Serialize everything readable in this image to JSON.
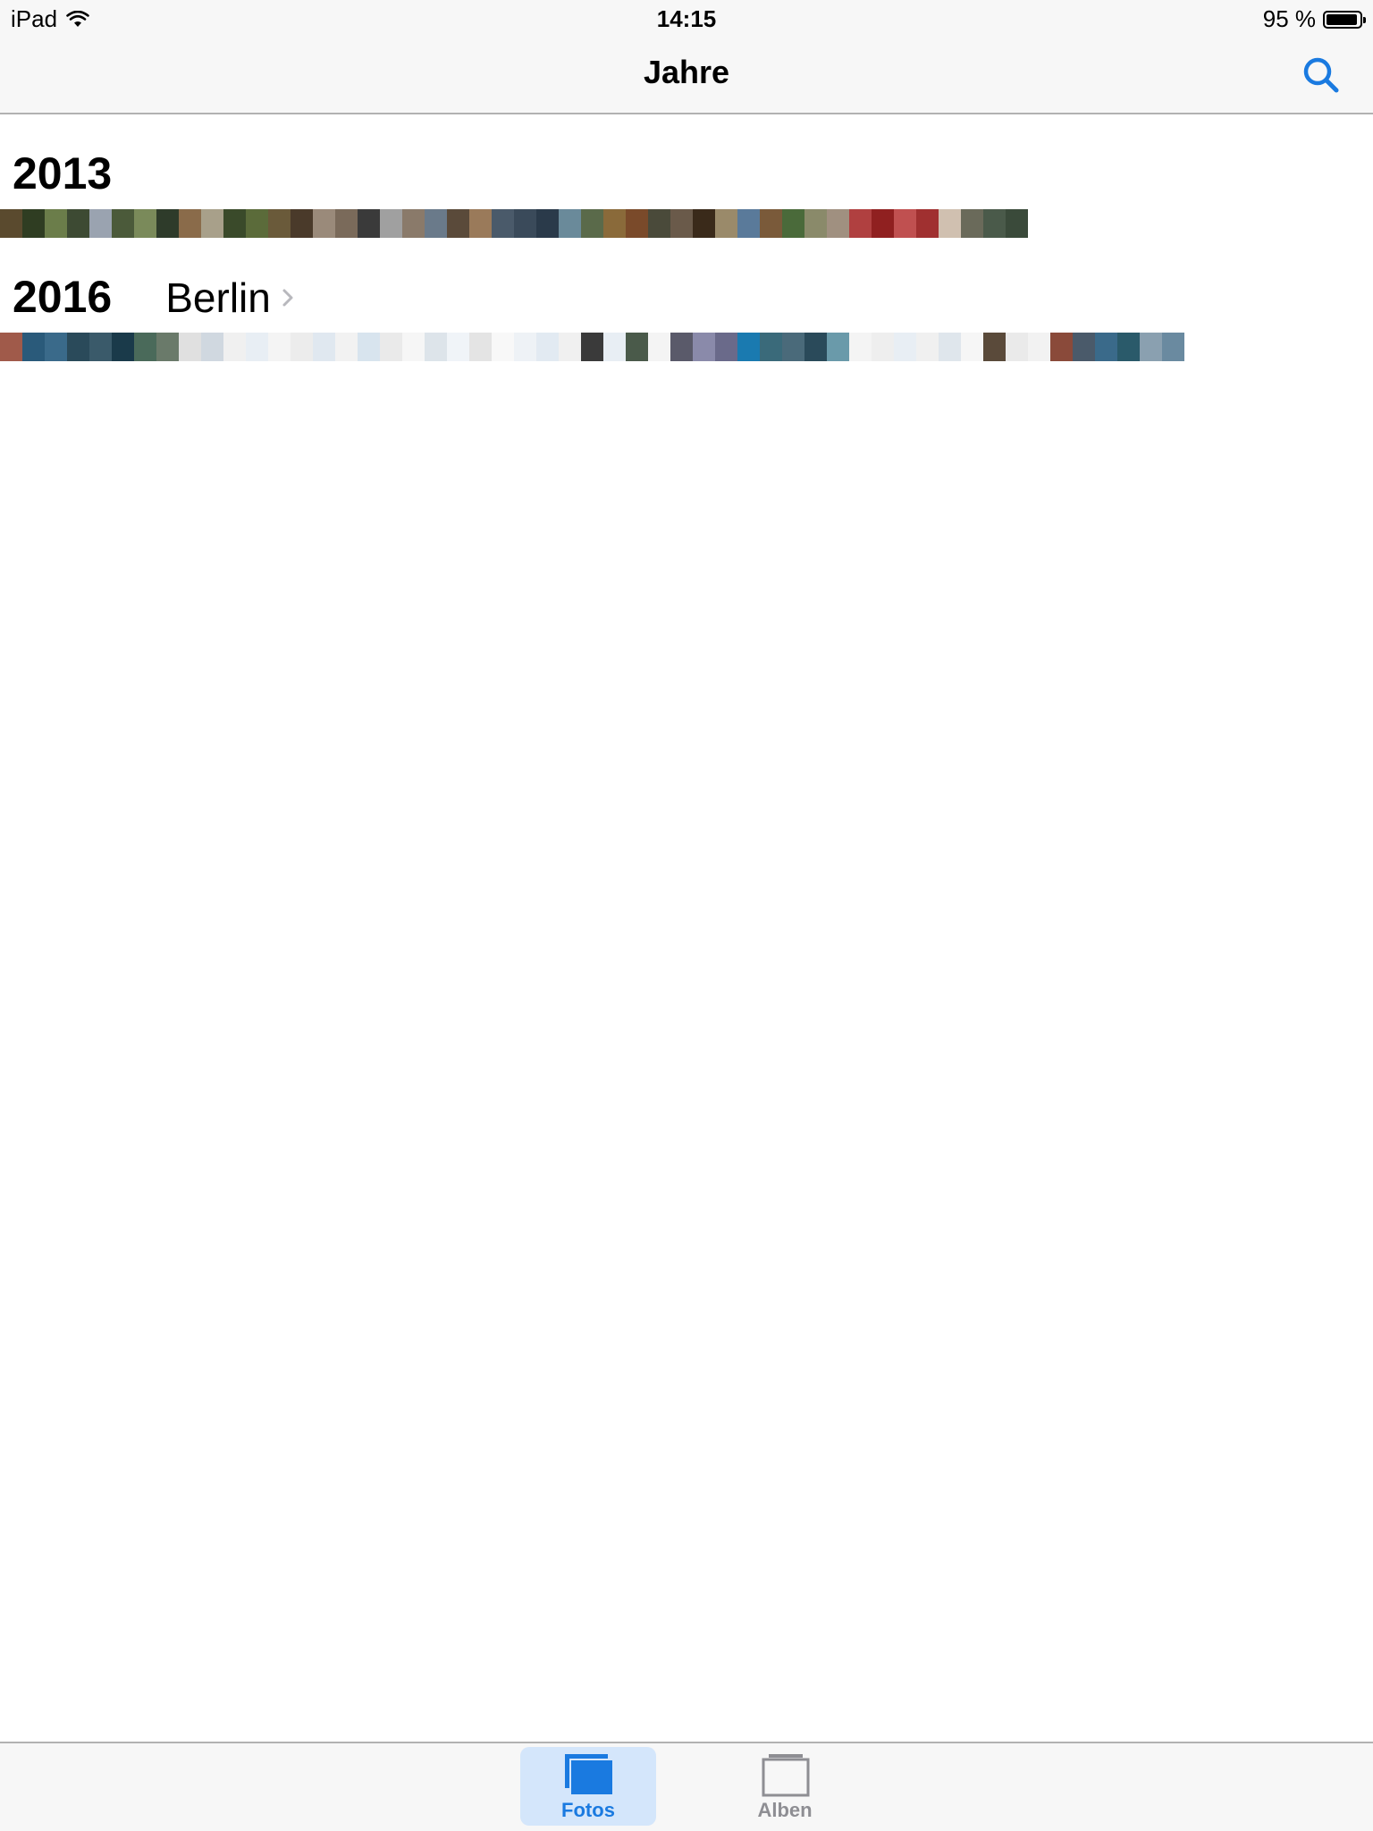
{
  "status": {
    "device": "iPad",
    "time": "14:15",
    "battery": "95 %",
    "battery_level": 0.95
  },
  "nav": {
    "title": "Jahre"
  },
  "years": [
    {
      "year": "2013",
      "place": "",
      "thumbs": [
        "#5a4a2e",
        "#2f3d22",
        "#6b7d4a",
        "#3d4a33",
        "#9aa3b0",
        "#4b5a3a",
        "#7a8a5a",
        "#2e3b2a",
        "#8a6b4a",
        "#a8a08a",
        "#3a4a2a",
        "#5b6b3a",
        "#6a5a3a",
        "#4a3a2a",
        "#9a8a7a",
        "#7a6a5a",
        "#3a3a3a",
        "#a0a0a0",
        "#8a7a6a",
        "#6a7a8a",
        "#5a4a3a",
        "#9a7a5a",
        "#4a5a6a",
        "#3a4a5a",
        "#2a3a4a",
        "#6a8a9a",
        "#5a6a4a",
        "#8a6a3a",
        "#7a4a2a",
        "#4a4a3a",
        "#6a5a4a",
        "#3a2a1a",
        "#9a8a6a",
        "#5a7a9a",
        "#7a5a3a",
        "#4a6a3a",
        "#8a8a6a",
        "#a09080",
        "#b04040",
        "#902020",
        "#c05050",
        "#a03030",
        "#d0c0b0",
        "#6a6a5a",
        "#4a5a4a",
        "#3a4a3a"
      ]
    },
    {
      "year": "2016",
      "place": "Berlin",
      "thumbs": [
        "#a05a4a",
        "#2a5a7a",
        "#3a6a8a",
        "#2a4a5a",
        "#3a5a6a",
        "#1a3a4a",
        "#4a6a5a",
        "#6a7a6a",
        "#e0e0e0",
        "#d0d8e0",
        "#f0f0f0",
        "#e8eef4",
        "#f4f4f4",
        "#ececec",
        "#e0e8f0",
        "#f2f2f2",
        "#d8e4ee",
        "#eaeaea",
        "#f6f6f6",
        "#dde4ea",
        "#f0f4f8",
        "#e4e4e4",
        "#f8f8f8",
        "#eef2f6",
        "#e2eaf2",
        "#f0f0f0",
        "#3a3a3a",
        "#e8eef4",
        "#4a5a4a",
        "#f4f4f4",
        "#5a5a6a",
        "#8a8aaa",
        "#6a6a8a",
        "#1a7ab0",
        "#3a6a7a",
        "#4a6a7a",
        "#2a4a5a",
        "#6a9aaa",
        "#f4f4f4",
        "#eeeeee",
        "#e8eef4",
        "#f0f0f0",
        "#dfe6ec",
        "#f6f6f6",
        "#5a4a3a",
        "#eaeaea",
        "#f2f2f2",
        "#8a4a3a",
        "#4a5a6a",
        "#3a6a8a",
        "#2a5a6a",
        "#8aa0b0",
        "#6a8aa0"
      ]
    }
  ],
  "tabbar": {
    "tabs": [
      {
        "label": "Fotos",
        "selected": true
      },
      {
        "label": "Alben",
        "selected": false
      }
    ],
    "accent": "#1a7ae0",
    "inactive": "#8e8e93"
  }
}
